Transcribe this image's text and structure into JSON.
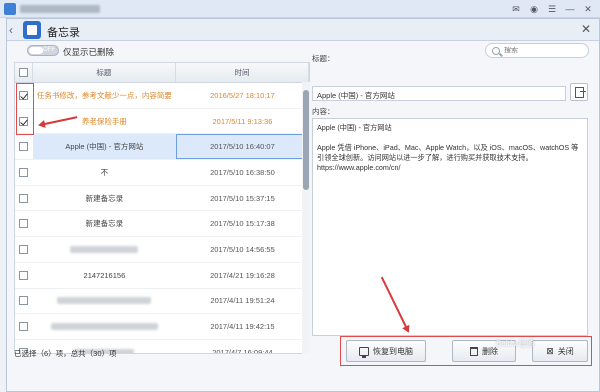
{
  "window": {
    "title": "备忘录"
  },
  "toolbar": {
    "toggle_state": "OFF",
    "toggle_label": "仅显示已删除",
    "search_placeholder": "搜索"
  },
  "table": {
    "columns": [
      "标题",
      "时间"
    ],
    "rows": [
      {
        "title": "任务书修改，参考文献少一点，内容简要",
        "time": "2016/5/27 18:10:17",
        "checked": true,
        "style": "orange"
      },
      {
        "title": "养老保险手册",
        "time": "2017/5/11 9:13:36",
        "checked": true,
        "style": "orange"
      },
      {
        "title": "Apple (中国) - 官方网站",
        "time": "2017/5/10 16:40:07",
        "checked": false,
        "style": "selected"
      },
      {
        "title": "不",
        "time": "2017/5/10 16:38:50",
        "checked": false,
        "style": ""
      },
      {
        "title": "新建备忘录",
        "time": "2017/5/10 15:37:15",
        "checked": false,
        "style": ""
      },
      {
        "title": "新建备忘录",
        "time": "2017/5/10 15:17:38",
        "checked": false,
        "style": ""
      },
      {
        "title": "",
        "time": "2017/5/10 14:56:55",
        "checked": false,
        "style": "blur"
      },
      {
        "title": "2147216156",
        "time": "2017/4/21 19:16:28",
        "checked": false,
        "style": ""
      },
      {
        "title": "",
        "time": "2017/4/11 19:51:24",
        "checked": false,
        "style": "blur"
      },
      {
        "title": "",
        "time": "2017/4/11 19:42:15",
        "checked": false,
        "style": "blur"
      },
      {
        "title": "",
        "time": "2017/4/7 16:09:44",
        "checked": false,
        "style": "blur"
      }
    ]
  },
  "detail": {
    "title_label": "标题：",
    "title_value": "Apple (中国) - 官方网站",
    "content_label": "内容：",
    "content_line1": "Apple (中国) - 官方网站",
    "content_line2": "Apple 凭借 iPhone、iPad、Mac、Apple Watch，以及 iOS、macOS、watchOS 等引领全球创新。访问网站以进一步了解，进行购买并获取技术支持。",
    "content_line3": "https://www.apple.com/cn/"
  },
  "footer": {
    "status": "已选择（6）项，总共（30）项",
    "restore_label": "恢复到电脑",
    "delete_label": "删除",
    "close_label": "关闭"
  },
  "watermark": "Baidu 经验",
  "colors": {
    "accent": "#2f6fcc",
    "highlight_orange": "#e0872a",
    "annotation_red": "#e24b4b"
  }
}
